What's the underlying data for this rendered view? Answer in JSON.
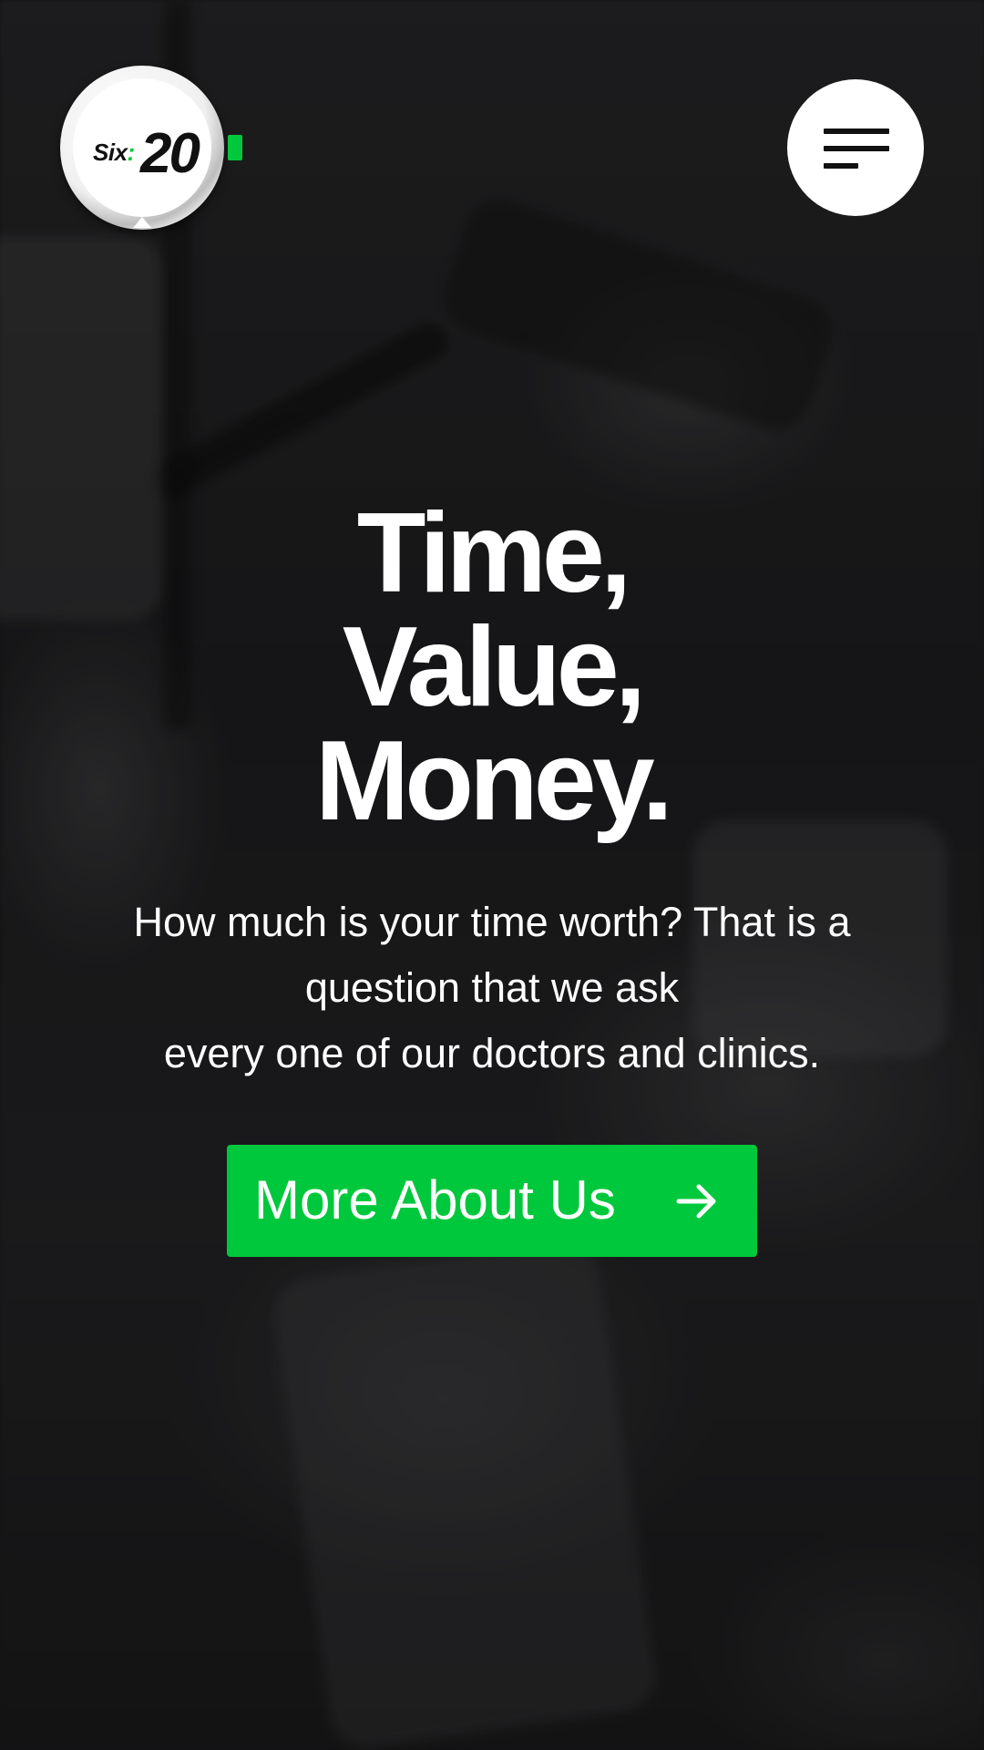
{
  "header": {
    "logo": {
      "six_text": "Six",
      "colon_text": ":",
      "number_text": "20"
    },
    "menu_icon": "hamburger-menu-icon"
  },
  "hero": {
    "headline": [
      "Time,",
      "Value,",
      "Money."
    ],
    "intro_lines": [
      "How much is your time worth? That is a",
      "question that we ask",
      "every one of our doctors and clinics."
    ],
    "cta": {
      "label": "More About Us",
      "icon": "arrow-right-icon"
    }
  },
  "colors": {
    "accent": "#00c83c",
    "text": "#ffffff",
    "background": "#1d1d1f"
  }
}
